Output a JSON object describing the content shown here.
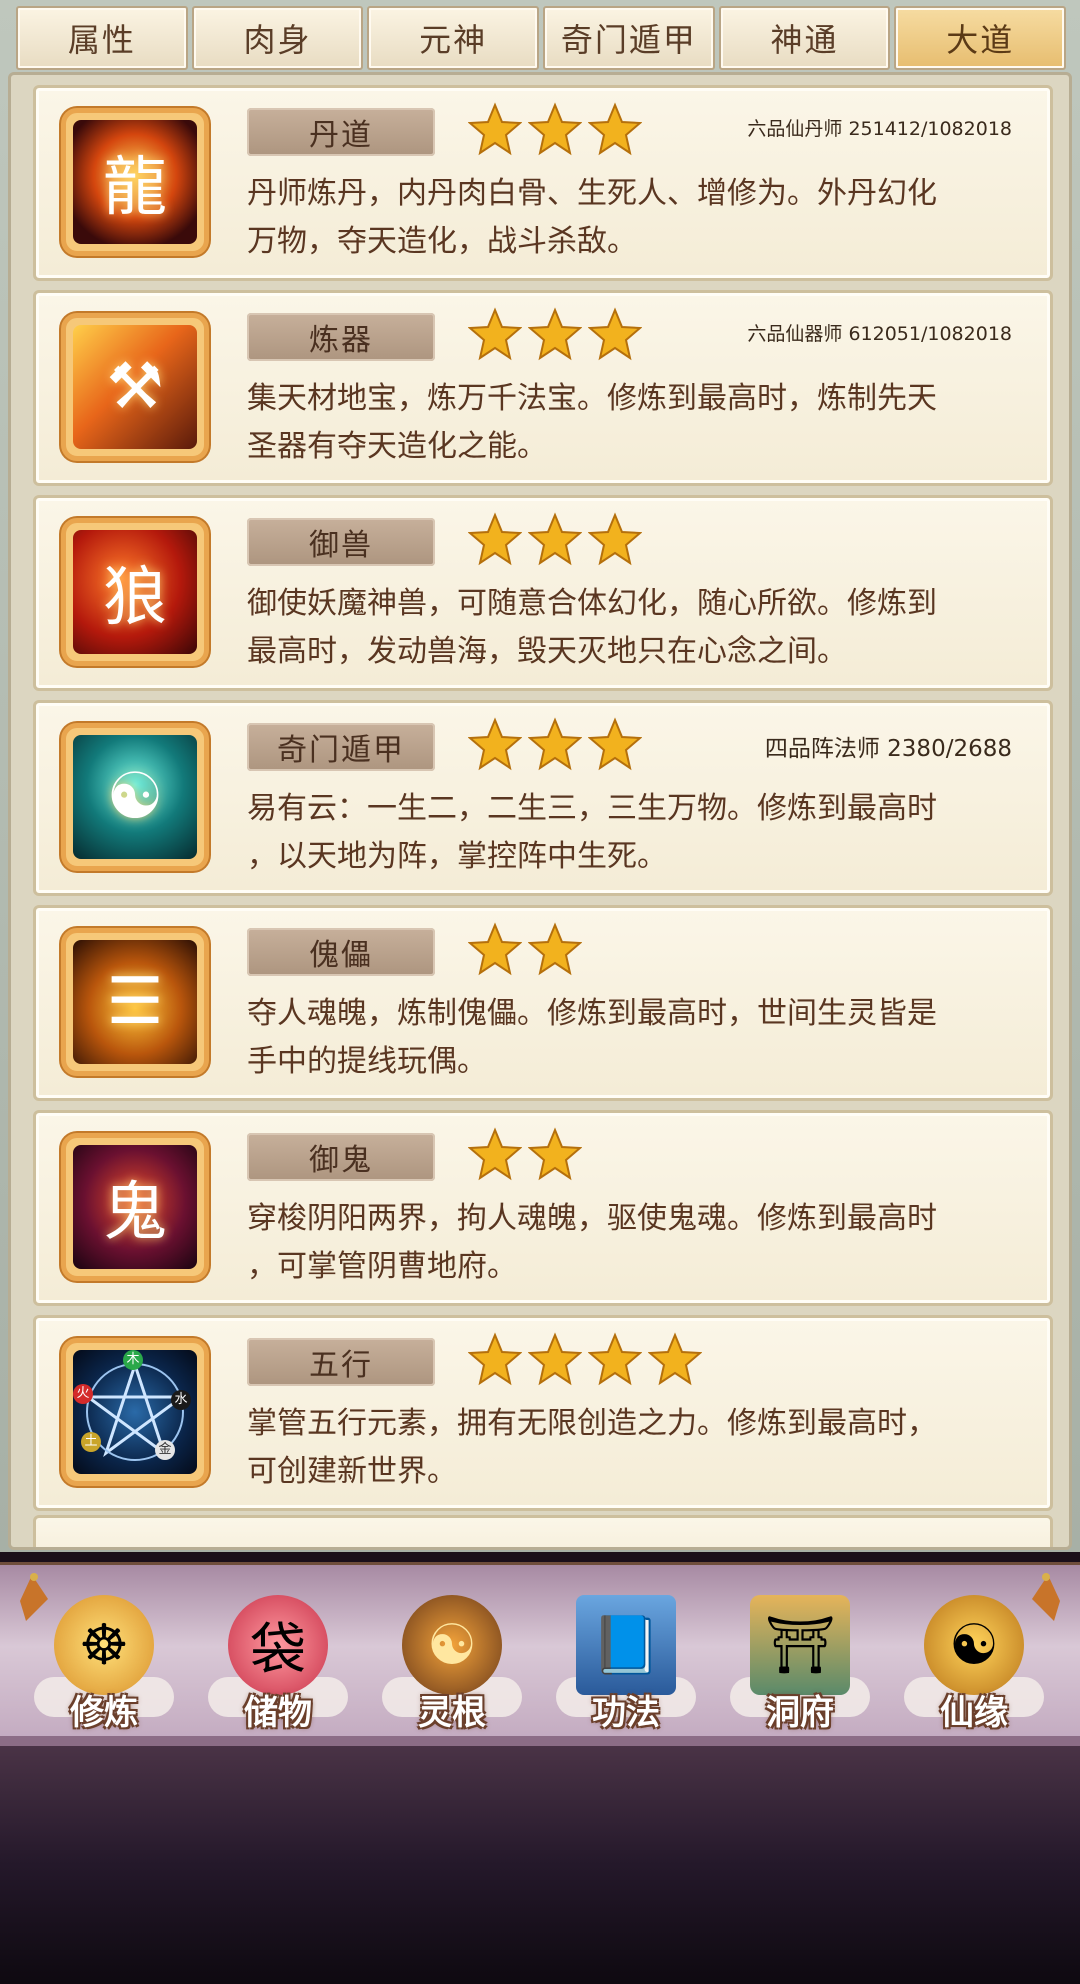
{
  "tabs": [
    {
      "label": "属性",
      "active": false
    },
    {
      "label": "肉身",
      "active": false
    },
    {
      "label": "元神",
      "active": false
    },
    {
      "label": "奇门遁甲",
      "active": false
    },
    {
      "label": "神通",
      "active": false
    },
    {
      "label": "大道",
      "active": true
    }
  ],
  "dao_list": [
    {
      "name": "丹道",
      "stars": 3,
      "rank": "六品仙丹师 251412/1082018",
      "desc_lines": [
        "丹师炼丹，内丹肉白骨、生死人、增修为。外丹幻化",
        "万物，夺天造化，战斗杀敌。"
      ],
      "icon": "alchemy-dragon-orb-icon"
    },
    {
      "name": "炼器",
      "stars": 3,
      "rank": "六品仙器师 612051/1082018",
      "desc_lines": [
        "集天材地宝，炼万千法宝。修炼到最高时，炼制先天",
        "圣器有夺天造化之能。"
      ],
      "icon": "forge-hammer-icon"
    },
    {
      "name": "御兽",
      "stars": 3,
      "rank": "",
      "desc_lines": [
        "御使妖魔神兽，可随意合体幻化，随心所欲。修炼到",
        "最高时，发动兽海，毁天灭地只在心念之间。"
      ],
      "icon": "beast-wolf-icon"
    },
    {
      "name": "奇门遁甲",
      "stars": 3,
      "rank": "四品阵法师 2380/2688",
      "desc_lines": [
        "易有云：一生二，二生三，三生万物。修炼到最高时",
        "，以天地为阵，掌控阵中生死。"
      ],
      "icon": "formation-sage-icon"
    },
    {
      "name": "傀儡",
      "stars": 2,
      "rank": "",
      "desc_lines": [
        "夺人魂魄，炼制傀儡。修炼到最高时，世间生灵皆是",
        "手中的提线玩偶。"
      ],
      "icon": "puppet-cat-icon"
    },
    {
      "name": "御鬼",
      "stars": 2,
      "rank": "",
      "desc_lines": [
        "穿梭阴阳两界，拘人魂魄，驱使鬼魂。修炼到最高时",
        "，可掌管阴曹地府。"
      ],
      "icon": "ghost-demon-icon"
    },
    {
      "name": "五行",
      "stars": 4,
      "rank": "",
      "desc_lines": [
        "掌管五行元素，拥有无限创造之力。修炼到最高时，",
        "可创建新世界。"
      ],
      "icon": "five-elements-pentagram-icon",
      "element_labels": [
        "木",
        "火",
        "土",
        "金",
        "水"
      ]
    }
  ],
  "nav": [
    {
      "label": "修炼",
      "icon": "meditating-monk-icon"
    },
    {
      "label": "储物",
      "icon": "storage-bag-icon"
    },
    {
      "label": "灵根",
      "icon": "spirit-root-swirl-icon"
    },
    {
      "label": "功法",
      "icon": "technique-book-icon"
    },
    {
      "label": "洞府",
      "icon": "cave-palace-icon"
    },
    {
      "label": "仙缘",
      "icon": "gourd-fortune-icon"
    }
  ],
  "colors": {
    "accent": "#e7bd6f",
    "text_brown": "#5a3621",
    "star_gold": "#f2b21e"
  }
}
